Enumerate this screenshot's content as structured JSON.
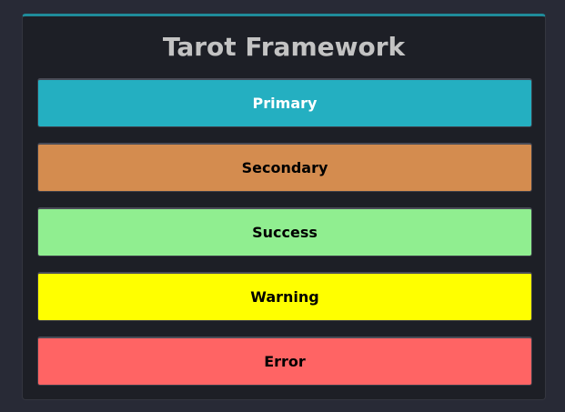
{
  "app": {
    "title": "Tarot Framework"
  },
  "buttons": {
    "primary": {
      "label": "Primary",
      "color": "#24afc1"
    },
    "secondary": {
      "label": "Secondary",
      "color": "#d48c4f"
    },
    "success": {
      "label": "Success",
      "color": "#90ee90"
    },
    "warning": {
      "label": "Warning",
      "color": "#ffff00"
    },
    "error": {
      "label": "Error",
      "color": "#ff6464"
    }
  }
}
